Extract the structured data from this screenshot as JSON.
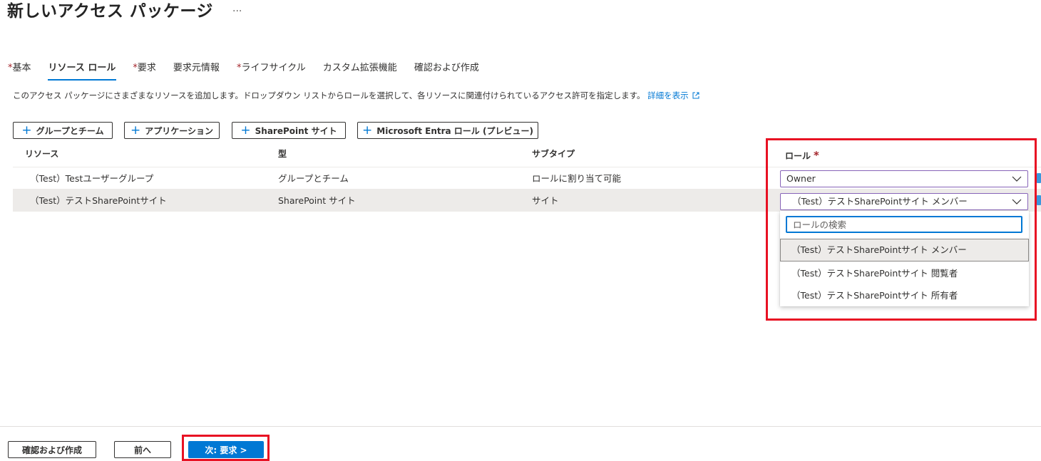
{
  "header": {
    "title": "新しいアクセス パッケージ",
    "more": "···"
  },
  "tabs": [
    {
      "required": "*",
      "label": "基本",
      "active": false
    },
    {
      "required": "",
      "label": "リソース ロール",
      "active": true
    },
    {
      "required": "*",
      "label": "要求",
      "active": false
    },
    {
      "required": "",
      "label": "要求元情報",
      "active": false
    },
    {
      "required": "*",
      "label": "ライフサイクル",
      "active": false
    },
    {
      "required": "",
      "label": "カスタム拡張機能",
      "active": false
    },
    {
      "required": "",
      "label": "確認および作成",
      "active": false
    }
  ],
  "description": {
    "text": "このアクセス パッケージにさまざまなリソースを追加します。ドロップダウン リストからロールを選択して、各リソースに関連付けられているアクセス許可を指定します。",
    "link": "詳細を表示"
  },
  "add_buttons": {
    "groups": "グループとチーム",
    "apps": "アプリケーション",
    "sharepoint": "SharePoint サイト",
    "entra": "Microsoft Entra ロール (プレビュー)"
  },
  "table": {
    "headers": {
      "resource": "リソース",
      "type": "型",
      "subtype": "サブタイプ",
      "role": "ロール",
      "role_required": "*"
    },
    "rows": [
      {
        "resource": "（Test）Testユーザーグループ",
        "type": "グループとチーム",
        "subtype": "ロールに割り当て可能",
        "role": "Owner"
      },
      {
        "resource": "（Test）テストSharePointサイト",
        "type": "SharePoint サイト",
        "subtype": "サイト",
        "role": "（Test）テストSharePointサイト メンバー"
      }
    ]
  },
  "role_dropdown": {
    "search_placeholder": "ロールの検索",
    "options": [
      "（Test）テストSharePointサイト メンバー",
      "（Test）テストSharePointサイト 閲覧者",
      "（Test）テストSharePointサイト 所有者"
    ],
    "selected_index": 0
  },
  "footer": {
    "review": "確認および作成",
    "prev": "前へ",
    "next": "次: 要求 >"
  },
  "colors": {
    "accent": "#0078d4",
    "highlight": "#e81123",
    "required": "#a4262c",
    "dropdown_border": "#8764b8"
  }
}
